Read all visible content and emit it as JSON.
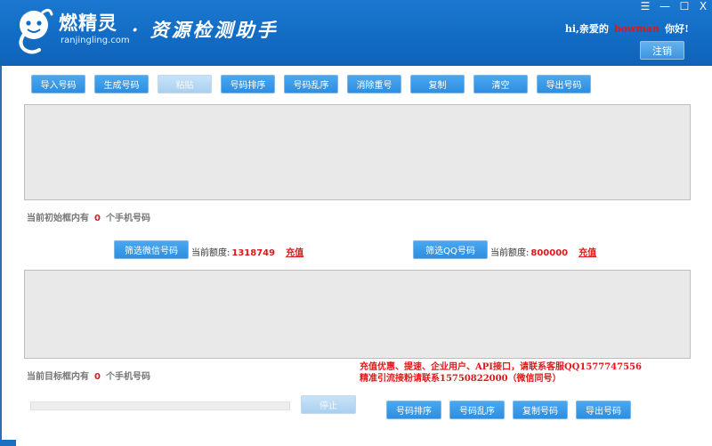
{
  "header": {
    "brand": "燃精灵",
    "brand_sub": "ranjingling.com",
    "app_title": "· 资源检测助手",
    "greeting_prefix": "hi,亲爱的",
    "username": "bowman",
    "greeting_suffix": "你好!",
    "logout_label": "注销",
    "window_controls": {
      "menu": "☰",
      "minimize": "—",
      "maximize": "☐",
      "close": "X"
    }
  },
  "toolbar": {
    "import": "导入号码",
    "generate": "生成号码",
    "paste": "粘贴",
    "sort": "号码排序",
    "shuffle": "号码乱序",
    "dedupe": "消除重号",
    "copy": "复制",
    "clear": "清空",
    "export": "导出号码"
  },
  "source_box": {
    "value": "",
    "count_prefix": "当前初始框内有",
    "count": "0",
    "count_suffix": "个手机号码"
  },
  "wechat": {
    "filter_label": "筛选微信号码",
    "quota_label": "当前额度:",
    "quota_value": "1318749",
    "recharge_label": "充值"
  },
  "qq": {
    "filter_label": "筛选QQ号码",
    "quota_label": "当前额度:",
    "quota_value": "800000",
    "recharge_label": "充值"
  },
  "target_box": {
    "value": "",
    "count_prefix": "当前目标框内有",
    "count": "0",
    "count_suffix": "个手机号码"
  },
  "promo": {
    "line1": "充值优惠、提速、企业用户、API接口，请联系客服QQ1577747556",
    "line2": "精准引流接粉请联系15750822000（微信同号）"
  },
  "bottom_actions": {
    "stop": "停止",
    "sort": "号码排序",
    "shuffle": "号码乱序",
    "copy": "复制号码",
    "export": "导出号码"
  },
  "progress": {
    "value": 0
  },
  "colors": {
    "header": "#136cc4",
    "button": "#3b9be6",
    "accent_red": "#d81a1a"
  }
}
